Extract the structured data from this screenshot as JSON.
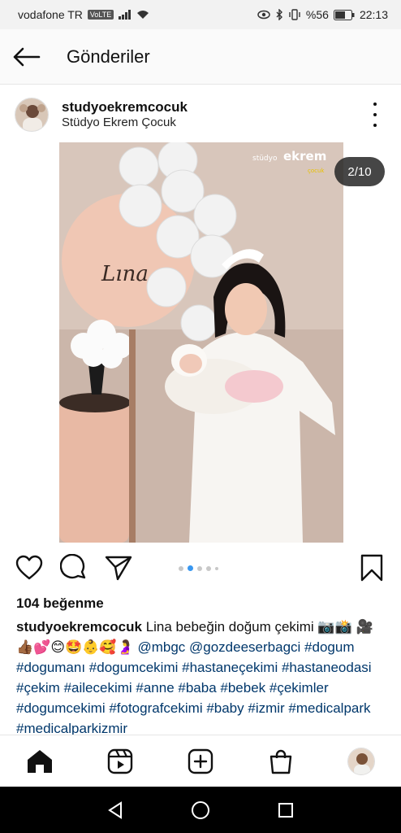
{
  "status_bar": {
    "carrier": "vodafone TR",
    "volte": "VoLTE",
    "battery": "%56",
    "time": "22:13"
  },
  "app_bar": {
    "title": "Gönderiler"
  },
  "post": {
    "username": "studyoekremcocuk",
    "location": "Stüdyo Ekrem Çocuk",
    "photo_counter": "2/10",
    "photo_text": {
      "sign": "Lına",
      "watermark_brand": "stüdyo",
      "watermark_name": "ekrem",
      "watermark_sub": "çocuk"
    },
    "carousel": {
      "total_visible_dots": 5,
      "active_index": 1
    },
    "likes": "104 beğenme",
    "caption": {
      "username": "studyoekremcocuk",
      "text": "Lina bebeğin doğum çekimi 📷📸",
      "emojis": "🎥👍🏾💕😊🤩👶🥰🤰",
      "mentions": "@mbgc @gozdeeserbagci",
      "hashtags": "#dogum #dogumanı #dogumcekimi #hastaneçekimi #hastaneodasi #çekim #ailecekimi #anne #baba #bebek #çekimler #dogumcekimi #fotografcekimi #baby #izmir #medicalpark #medicalparkizmir"
    }
  },
  "icons": {
    "back": "arrow-left-icon",
    "like": "heart-icon",
    "comment": "comment-icon",
    "share": "send-icon",
    "save": "bookmark-icon",
    "home": "home-icon",
    "reels": "reels-icon",
    "create": "plus-square-icon",
    "shop": "shopping-bag-icon",
    "profile": "avatar"
  },
  "colors": {
    "link": "#00376b",
    "active_dot": "#3897f0"
  }
}
